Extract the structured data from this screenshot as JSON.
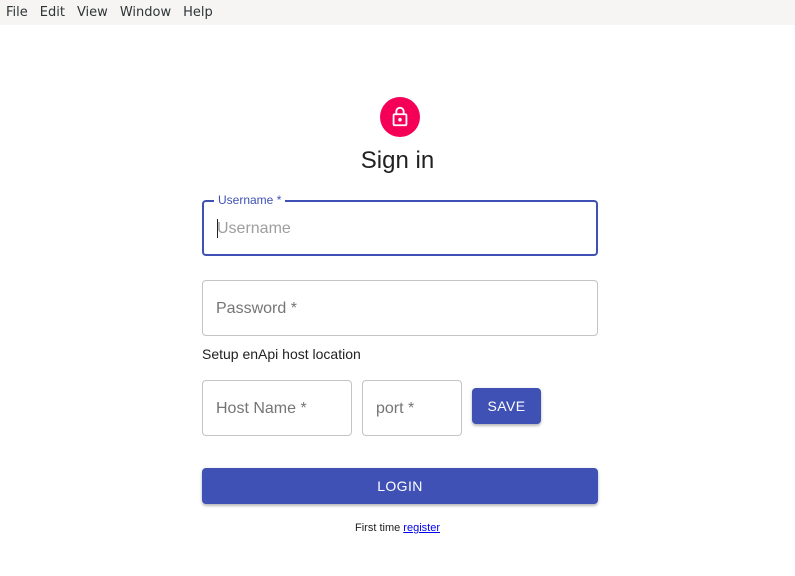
{
  "menubar": {
    "items": [
      "File",
      "Edit",
      "View",
      "Window",
      "Help"
    ]
  },
  "header": {
    "icon": "lock-icon",
    "title": "Sign in"
  },
  "form": {
    "username": {
      "label": "Username *",
      "placeholder": "Username",
      "value": ""
    },
    "password": {
      "label": "Password *",
      "value": ""
    },
    "setup_text": "Setup enApi host location",
    "host": {
      "label": "Host Name *",
      "value": ""
    },
    "port": {
      "label": "port *",
      "value": ""
    },
    "save_label": "SAVE",
    "login_label": "LOGIN"
  },
  "footer": {
    "prefix": "First time",
    "link_label": "register"
  },
  "colors": {
    "primary": "#3f51b5",
    "avatar": "#f50057"
  }
}
